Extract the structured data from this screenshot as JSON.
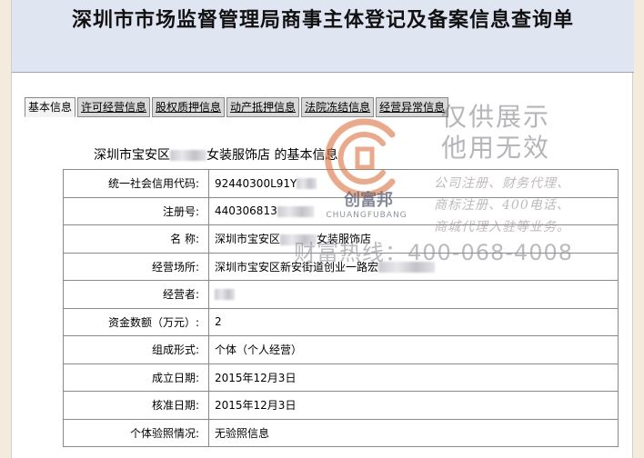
{
  "page": {
    "title": "深圳市市场监督管理局商事主体登记及备案信息查询单"
  },
  "tabs": [
    {
      "label": "基本信息",
      "active": true
    },
    {
      "label": "许可经营信息",
      "active": false
    },
    {
      "label": "股权质押信息",
      "active": false
    },
    {
      "label": "动产抵押信息",
      "active": false
    },
    {
      "label": "法院冻结信息",
      "active": false
    },
    {
      "label": "经营异常信息",
      "active": false
    }
  ],
  "section": {
    "prefix": "深圳市宝安区",
    "suffix": "女装服饰店  的基本信息"
  },
  "rows": [
    {
      "key": "统一社会信用代码:",
      "value": "92440300L91Y"
    },
    {
      "key": "注册号:",
      "value": "440306813"
    },
    {
      "key": "名  称:",
      "value": "深圳市宝安区",
      "value_suffix": "女装服饰店"
    },
    {
      "key": "经营场所:",
      "value": "深圳市宝安区新安街道创业一路宏"
    },
    {
      "key": "经营者:",
      "value": ""
    },
    {
      "key": "资金数额（万元）:",
      "value": "2"
    },
    {
      "key": "组成形式:",
      "value": "个体（个人经营）"
    },
    {
      "key": "成立日期:",
      "value": "2015年12月3日"
    },
    {
      "key": "核准日期:",
      "value": "2015年12月3日"
    },
    {
      "key": "个体验照情况:",
      "value": "无验照信息"
    }
  ],
  "watermark": {
    "line1": "仅供展示",
    "line2": "他用无效",
    "services1": "公司注册、财务代理、",
    "services2": "商标注册、400电话、",
    "services3": "商城代理入驻等业务。",
    "hotline": "财富热线：400-068-4008",
    "logo_name": "创富邦",
    "logo_sub": "CHUANGFUBANG",
    "logo_color": "#e0703a"
  }
}
